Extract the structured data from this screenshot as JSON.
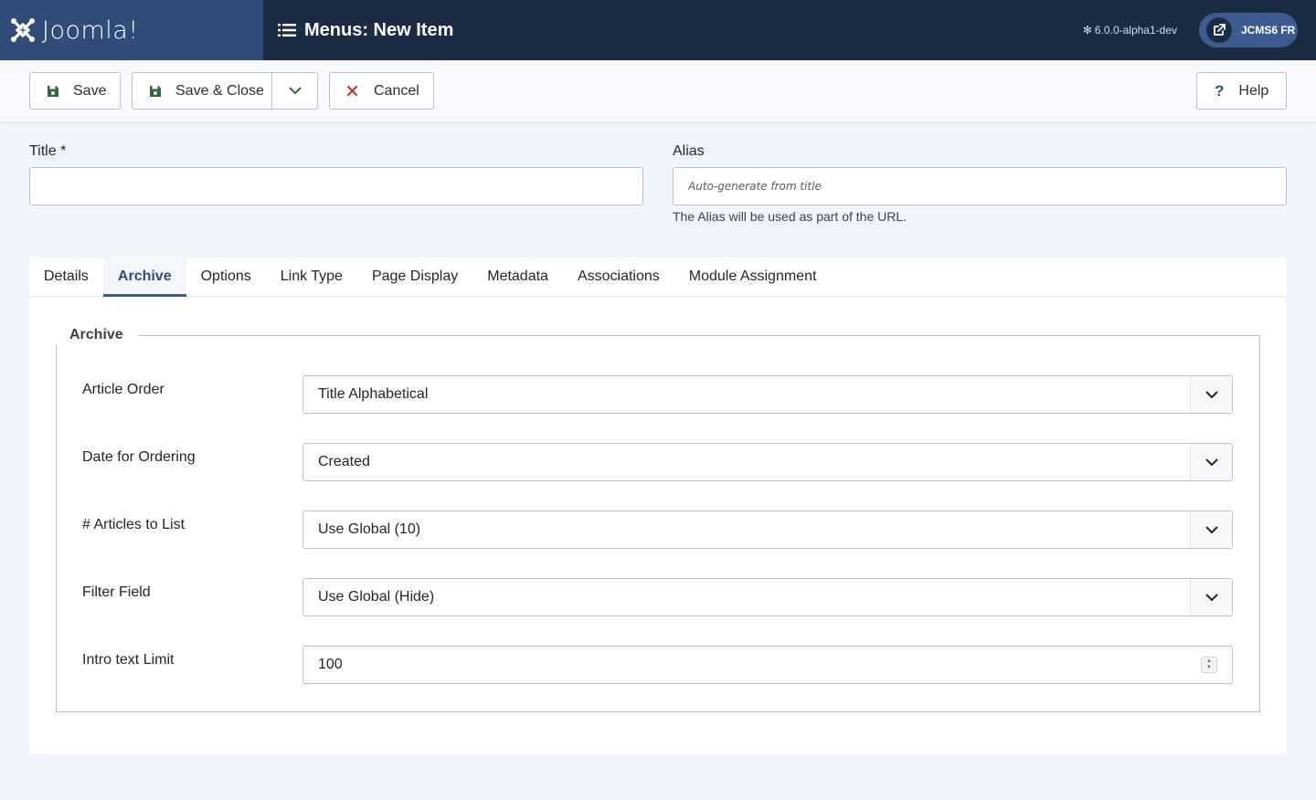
{
  "header": {
    "brand": "Joomla!",
    "title": "Menus: New Item",
    "version": "6.0.0-alpha1-dev",
    "site_button": "JCMS6 FR",
    "icons": [
      "joomla-logo-icon",
      "list-icon",
      "external-link-icon"
    ]
  },
  "toolbar": {
    "save": "Save",
    "save_close": "Save & Close",
    "cancel": "Cancel",
    "help": "Help",
    "help_glyph": "?"
  },
  "form": {
    "title_label": "Title *",
    "title_value": "",
    "alias_label": "Alias",
    "alias_placeholder": "Auto-generate from title",
    "alias_help": "The Alias will be used as part of the URL."
  },
  "tabs": [
    {
      "label": "Details",
      "active": false
    },
    {
      "label": "Archive",
      "active": true
    },
    {
      "label": "Options",
      "active": false
    },
    {
      "label": "Link Type",
      "active": false
    },
    {
      "label": "Page Display",
      "active": false
    },
    {
      "label": "Metadata",
      "active": false
    },
    {
      "label": "Associations",
      "active": false
    },
    {
      "label": "Module Assignment",
      "active": false
    }
  ],
  "archive": {
    "legend": "Archive",
    "fields": [
      {
        "label": "Article Order",
        "value": "Title Alphabetical"
      },
      {
        "label": "Date for Ordering",
        "value": "Created"
      },
      {
        "label": "# Articles to List",
        "value": "Use Global (10)"
      },
      {
        "label": "Filter Field",
        "value": "Use Global (Hide)"
      },
      {
        "label": "Intro text Limit",
        "value": "100"
      }
    ]
  },
  "colors": {
    "header_bg": "#1c2b44",
    "brand_bg": "#2f4d78",
    "accent": "#3c5b8e",
    "save_icon": "#2f6b3a",
    "cancel_icon": "#c52827"
  }
}
